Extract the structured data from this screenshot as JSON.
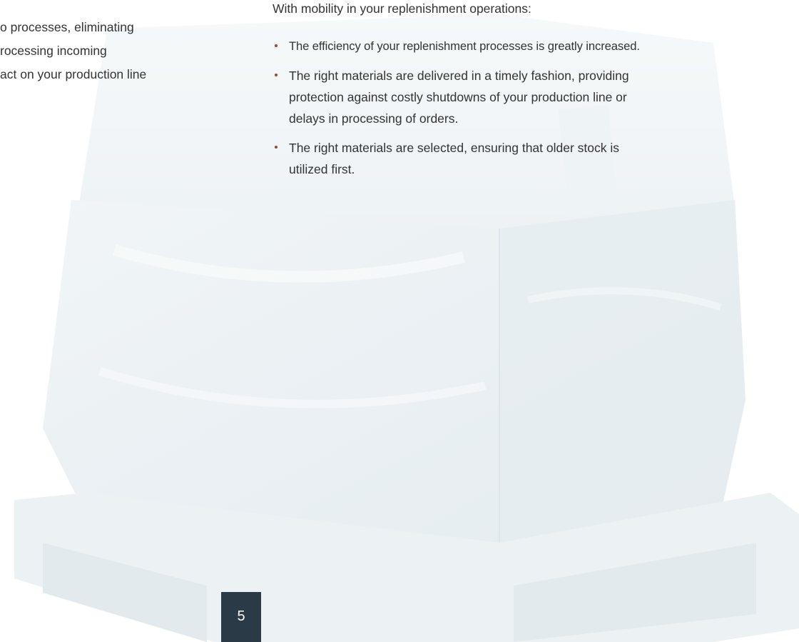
{
  "left_fragment": {
    "lines": [
      "o processes, eliminating",
      "rocessing incoming",
      "act on your production line"
    ]
  },
  "right_column": {
    "intro": "With mobility in your replenishment operations:",
    "bullets": [
      {
        "lines": [
          "The efficiency of your replenishment processes is greatly increased."
        ]
      },
      {
        "lines": [
          "The right materials are delivered in a timely fashion, providing",
          "protection against costly shutdowns of your production line or",
          "delays in processing of orders."
        ]
      },
      {
        "lines": [
          "The right materials are selected, ensuring that older stock is",
          "utilized first."
        ]
      }
    ]
  },
  "page_number": "5",
  "colors": {
    "bullet": "#a5432b",
    "page_number_bg": "#2a3a47",
    "text": "#333333"
  }
}
